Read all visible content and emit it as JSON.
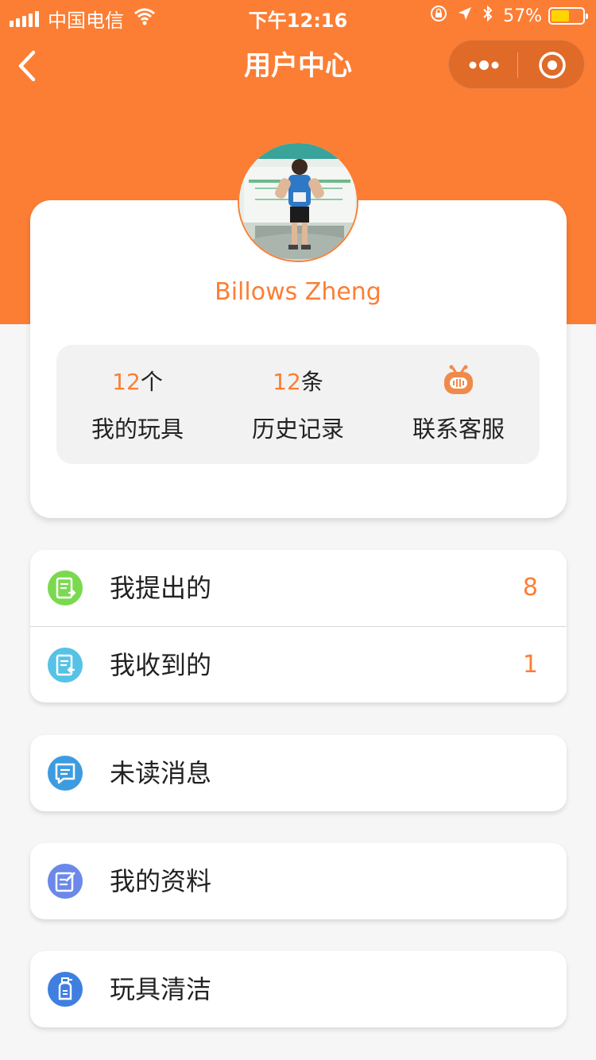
{
  "status_bar": {
    "carrier": "中国电信",
    "time": "下午12:16",
    "battery": "57%",
    "battery_level": 0.57
  },
  "nav": {
    "title": "用户中心"
  },
  "profile": {
    "username": "Billows Zheng",
    "stats": [
      {
        "number": "12",
        "unit": "个",
        "label": "我的玩具"
      },
      {
        "number": "12",
        "unit": "条",
        "label": "历史记录"
      },
      {
        "icon": "customer-service-robot-icon",
        "label": "联系客服"
      }
    ]
  },
  "menu": {
    "group1": [
      {
        "label": "我提出的",
        "count": "8",
        "icon": "submitted-doc-icon",
        "color": "#7ad94f"
      },
      {
        "label": "我收到的",
        "count": "1",
        "icon": "received-doc-icon",
        "color": "#56c2e6"
      }
    ],
    "unread": {
      "label": "未读消息",
      "icon": "message-icon",
      "color": "#3d9ce0"
    },
    "profile_info": {
      "label": "我的资料",
      "icon": "edit-profile-icon",
      "color": "#6b88ea"
    },
    "cleaning": {
      "label": "玩具清洁",
      "icon": "cleaner-bottle-icon",
      "color": "#3f7fe0"
    }
  },
  "colors": {
    "accent": "#fc7e34",
    "background": "#f6f6f6"
  }
}
